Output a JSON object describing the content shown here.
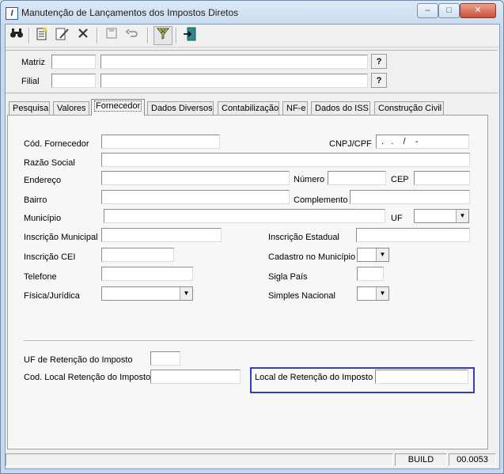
{
  "window": {
    "title": "Manutenção de Lançamentos dos Impostos Diretos",
    "app_icon": "I",
    "minimize": "–",
    "maximize": "□",
    "close": "✕"
  },
  "toolbar": {
    "icons": [
      "binoculars-icon",
      "new-document-icon",
      "edit-icon",
      "delete-icon",
      "save-icon",
      "undo-icon",
      "filter-icon",
      "exit-icon"
    ]
  },
  "header": {
    "matriz_label": "Matriz",
    "filial_label": "Filial",
    "lookup_button": "?"
  },
  "tabs": [
    "Pesquisa",
    "Valores",
    "Fornecedor",
    "Dados Diversos",
    "Contabilização",
    "NF-e",
    "Dados do ISS",
    "Construção Civil"
  ],
  "form": {
    "cod_fornecedor": "Cód. Fornecedor",
    "cnpj_cpf": "CNPJ/CPF",
    "cnpj_mask": " .   .    /    -",
    "razao_social": "Razão Social",
    "endereco": "Endereço",
    "numero": "Número",
    "cep": "CEP",
    "bairro": "Bairro",
    "complemento": "Complemento",
    "municipio": "Município",
    "uf": "UF",
    "inscricao_municipal": "Inscrição Municipal",
    "inscricao_estadual": "Inscrição Estadual",
    "inscricao_cei": "Inscrição CEI",
    "cadastro_municipio": "Cadastro no Município",
    "telefone": "Telefone",
    "sigla_pais": "Sigla País",
    "fisica_juridica": "Física/Jurídica",
    "simples_nacional": "Simples Nacional",
    "uf_retencao": "UF de Retenção do Imposto",
    "cod_local_retencao": "Cod. Local Retenção do Imposto",
    "local_retencao": "Local de Retenção do Imposto"
  },
  "status": {
    "build_label": "BUILD",
    "build_number": "00.0053"
  }
}
